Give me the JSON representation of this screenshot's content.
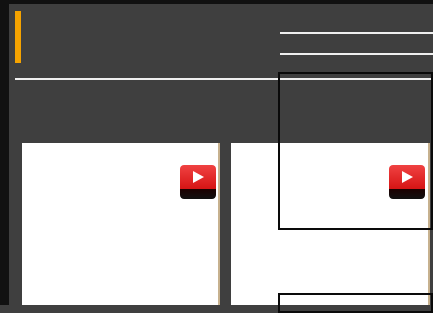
{
  "header": {
    "accent_color": "#f5a300",
    "icon": "accent-bar"
  },
  "cards": [
    {
      "icon": "video-play-icon",
      "icon_color": "#e32626"
    },
    {
      "icon": "video-play-icon",
      "icon_color": "#e32626"
    }
  ],
  "colors": {
    "background": "#3f3f3f",
    "card": "#ffffff",
    "divider": "#efefef"
  }
}
